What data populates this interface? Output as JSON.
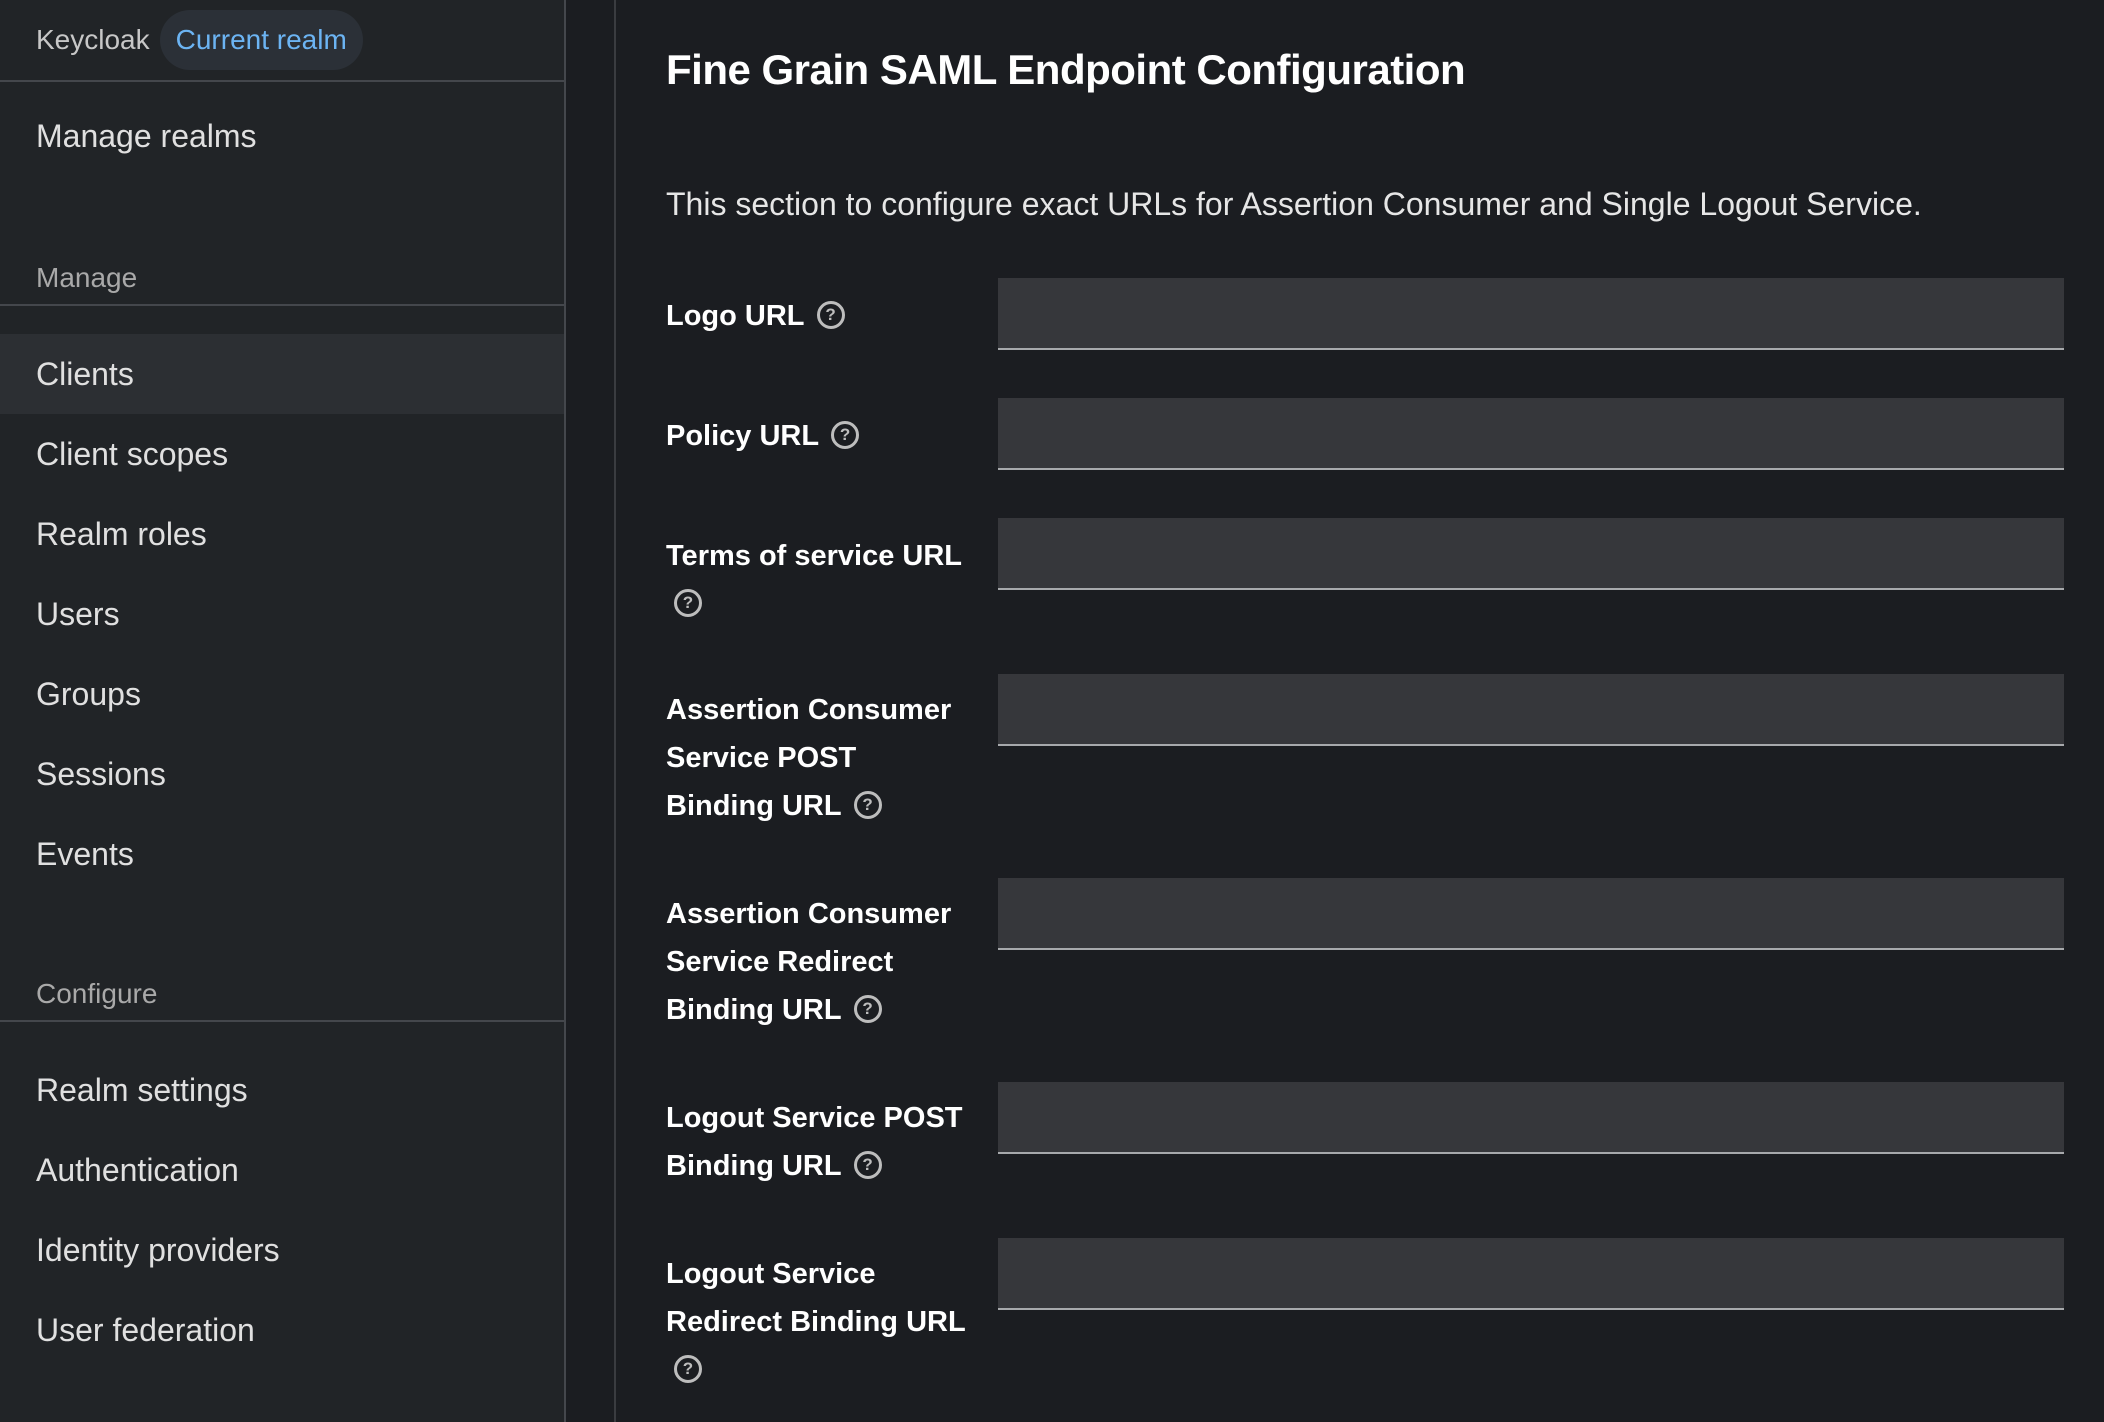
{
  "sidebar": {
    "brand": "Keycloak",
    "realm_chip": "Current realm",
    "manage_realms": "Manage realms",
    "manage_section": "Manage",
    "manage_items": [
      "Clients",
      "Client scopes",
      "Realm roles",
      "Users",
      "Groups",
      "Sessions",
      "Events"
    ],
    "configure_section": "Configure",
    "configure_items": [
      "Realm settings",
      "Authentication",
      "Identity providers",
      "User federation"
    ],
    "active_item": "Clients"
  },
  "main": {
    "title": "Fine Grain SAML Endpoint Configuration",
    "description": "This section to configure exact URLs for Assertion Consumer and Single Logout Service.",
    "fields": [
      {
        "label": "Logo URL",
        "value": ""
      },
      {
        "label": "Policy URL",
        "value": ""
      },
      {
        "label": "Terms of service URL",
        "value": ""
      },
      {
        "label": "Assertion Consumer Service POST Binding URL",
        "value": ""
      },
      {
        "label": "Assertion Consumer Service Redirect Binding URL",
        "value": ""
      },
      {
        "label": "Logout Service POST Binding URL",
        "value": ""
      },
      {
        "label": "Logout Service Redirect Binding URL",
        "value": ""
      }
    ],
    "help_icon": "question-circle-icon"
  }
}
